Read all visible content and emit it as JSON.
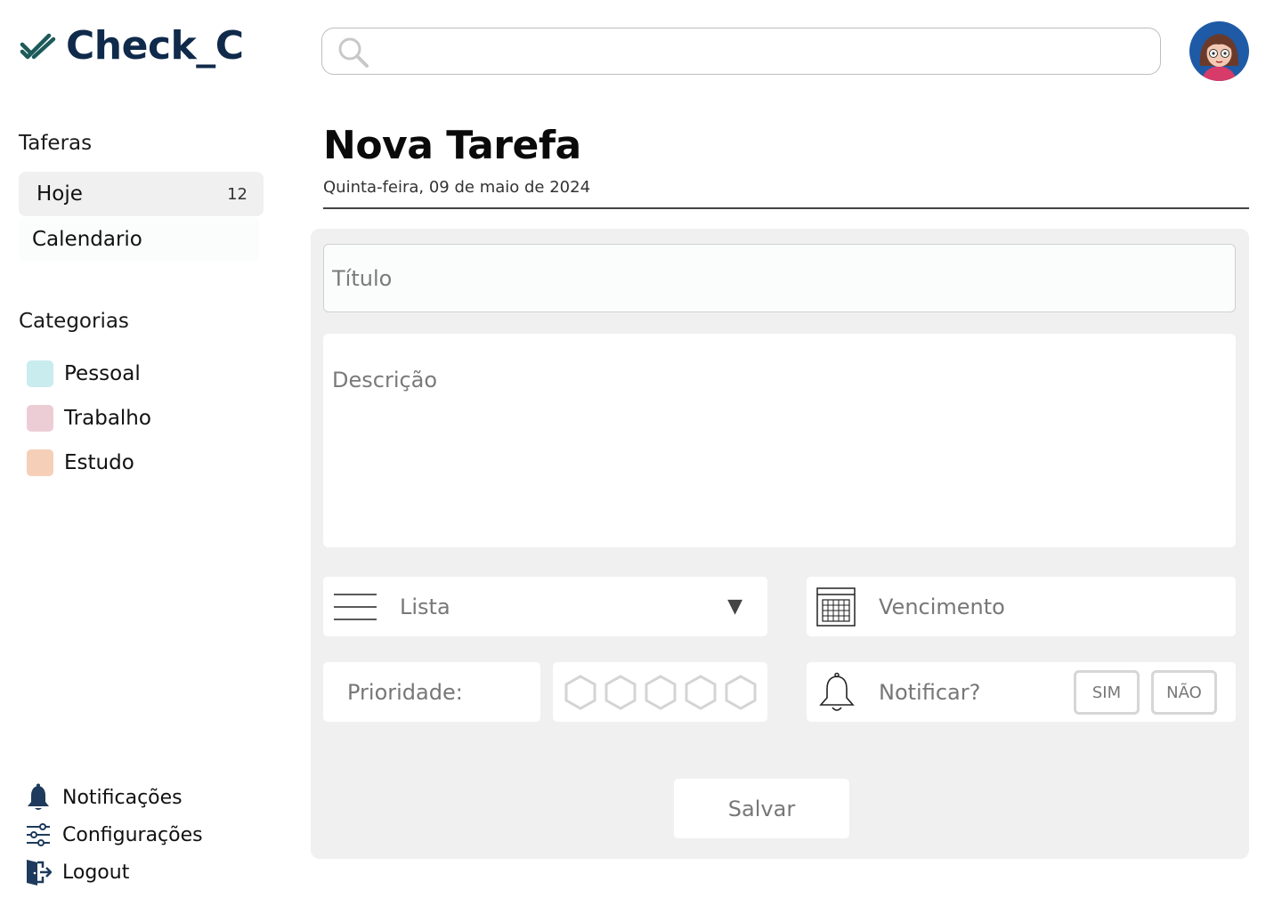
{
  "app": {
    "name": "Check_C"
  },
  "search": {
    "placeholder": ""
  },
  "sidebar": {
    "tasks_title": "Taferas",
    "tasks": [
      {
        "label": "Hoje",
        "count": "12"
      },
      {
        "label": "Calendario"
      }
    ],
    "categories_title": "Categorias",
    "categories": [
      {
        "label": "Pessoal",
        "color": "#c9ecee"
      },
      {
        "label": "Trabalho",
        "color": "#eccdd6"
      },
      {
        "label": "Estudo",
        "color": "#f5cfb7"
      }
    ],
    "bottom": [
      {
        "label": "Notificações",
        "icon": "bell-icon"
      },
      {
        "label": "Configurações",
        "icon": "sliders-icon"
      },
      {
        "label": "Logout",
        "icon": "logout-icon"
      }
    ]
  },
  "main": {
    "title": "Nova Tarefa",
    "date": "Quinta-feira, 09 de maio de 2024",
    "form": {
      "title_placeholder": "Título",
      "description_placeholder": "Descrição",
      "list_label": "Lista",
      "due_label": "Vencimento",
      "priority_label": "Prioridade:",
      "priority_level": 0,
      "priority_max": 5,
      "notify_label": "Notificar?",
      "yes_label": "SIM",
      "no_label": "NÃO",
      "save_label": "Salvar"
    }
  },
  "colors": {
    "brand": "#0f2a4a",
    "check": "#1d5a5a",
    "panel": "#f0f0f0"
  }
}
